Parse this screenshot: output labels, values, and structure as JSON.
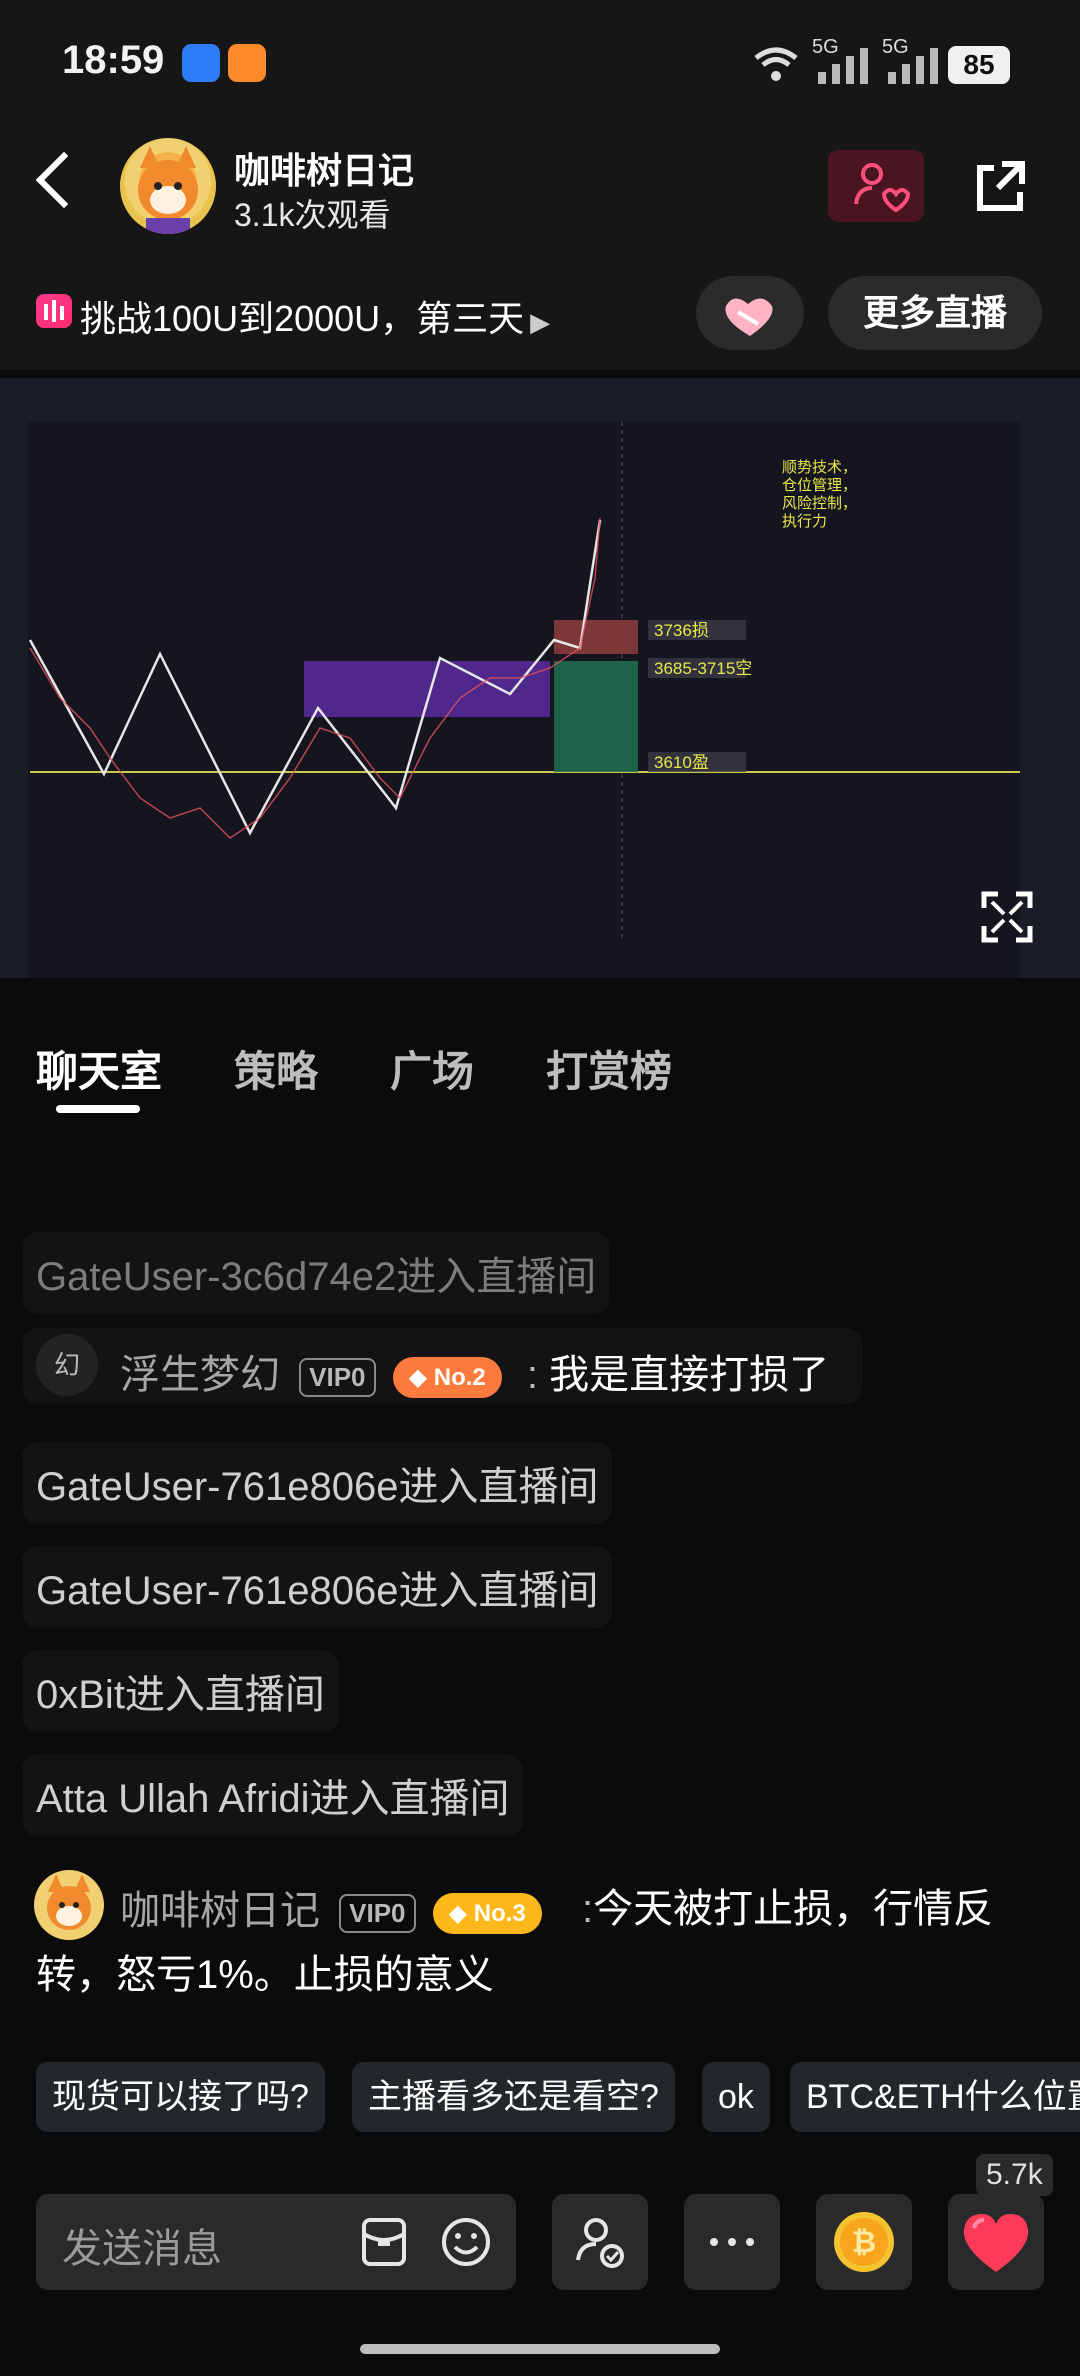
{
  "status_bar": {
    "time": "18:59",
    "network1": "5G",
    "network2": "5G",
    "battery": "85"
  },
  "header": {
    "host_name": "咖啡树日记",
    "views": "3.1k次观看"
  },
  "live": {
    "title": "挑战100U到2000U，第三天",
    "more_live_label": "更多直播"
  },
  "chart": {
    "annotation_lines": [
      "顺势技术，",
      "仓位管理，",
      "风险控制，",
      "执行力"
    ],
    "stop_label": "3736损",
    "entry_label": "3685-3715空",
    "target_label": "3610盈"
  },
  "tabs": [
    "聊天室",
    "策略",
    "广场",
    "打赏榜"
  ],
  "chat": [
    {
      "type": "system",
      "text": "GateUser-3c6d74e2进入直播间"
    },
    {
      "type": "user",
      "avatar_text": "幻",
      "name": "浮生梦幻",
      "vip": "VIP0",
      "rank": "No.2",
      "text": "我是直接打损了"
    },
    {
      "type": "system",
      "text": "GateUser-761e806e进入直播间"
    },
    {
      "type": "system",
      "text": "GateUser-761e806e进入直播间"
    },
    {
      "type": "system",
      "text": "0xBit进入直播间"
    },
    {
      "type": "system",
      "text": "Atta Ullah Afridi进入直播间"
    },
    {
      "type": "user",
      "name": "咖啡树日记",
      "vip": "VIP0",
      "rank": "No.3",
      "text": "今天被打止损，行情反转，怒亏1%。止损的意义"
    }
  ],
  "quick_replies": [
    "现货可以接了吗?",
    "主播看多还是看空?",
    "ok",
    "BTC&ETH什么位置"
  ],
  "input": {
    "placeholder": "发送消息"
  },
  "like_count": "5.7k",
  "colors": {
    "accent_pink": "#ff2a6e",
    "rank_orange": "#ff7a3d",
    "rank_gold": "#ffb81a",
    "chart_zone": "#5b2a9e",
    "stop_zone": "#8a3b3b",
    "profit_zone": "#1d6b4f"
  }
}
